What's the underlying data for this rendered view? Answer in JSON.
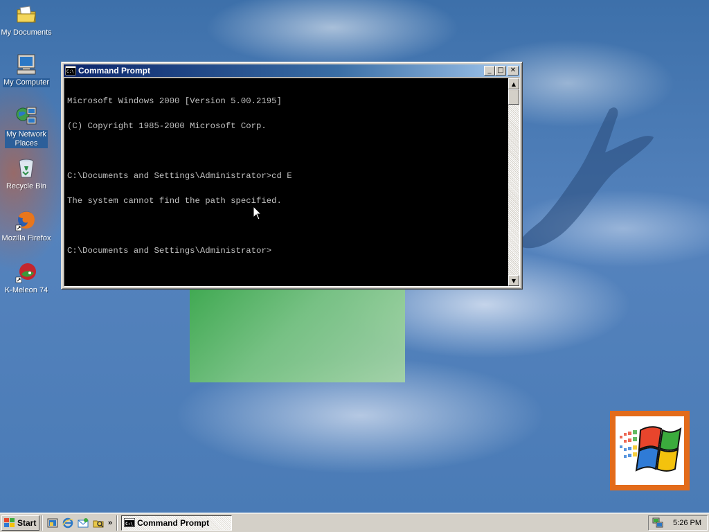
{
  "desktop": {
    "icons": [
      {
        "label": "My Documents",
        "icon": "folder-documents-icon"
      },
      {
        "label": "My Computer",
        "icon": "computer-icon"
      },
      {
        "label": "My Network Places",
        "icon": "network-places-icon"
      },
      {
        "label": "Recycle Bin",
        "icon": "recycle-bin-icon"
      },
      {
        "label": "Mozilla Firefox",
        "icon": "firefox-icon"
      },
      {
        "label": "K-Meleon 74",
        "icon": "kmeleon-icon"
      }
    ]
  },
  "window": {
    "title": "Command Prompt",
    "minimize_glyph": "_",
    "maximize_glyph": "□",
    "close_glyph": "✕",
    "console_lines": [
      "Microsoft Windows 2000 [Version 5.00.2195]",
      "(C) Copyright 1985-2000 Microsoft Corp.",
      "",
      "C:\\Documents and Settings\\Administrator>cd E",
      "The system cannot find the path specified.",
      "",
      "C:\\Documents and Settings\\Administrator>"
    ],
    "scroll_up_glyph": "▲",
    "scroll_down_glyph": "▼"
  },
  "taskbar": {
    "start_label": "Start",
    "quick_launch": [
      "show-desktop-icon",
      "internet-explorer-icon",
      "outlook-express-icon",
      "windows-explorer-icon"
    ],
    "more_glyph": "»",
    "tasks": [
      {
        "label": "Command Prompt",
        "active": true
      }
    ],
    "clock": "5:26 PM"
  },
  "colors": {
    "titlebar_start": "#0a246a",
    "titlebar_end": "#a6caf0",
    "console_bg": "#000000",
    "console_fg": "#c0c0c0",
    "chrome": "#d4d0c8",
    "desktop": "#3a6ea5"
  }
}
